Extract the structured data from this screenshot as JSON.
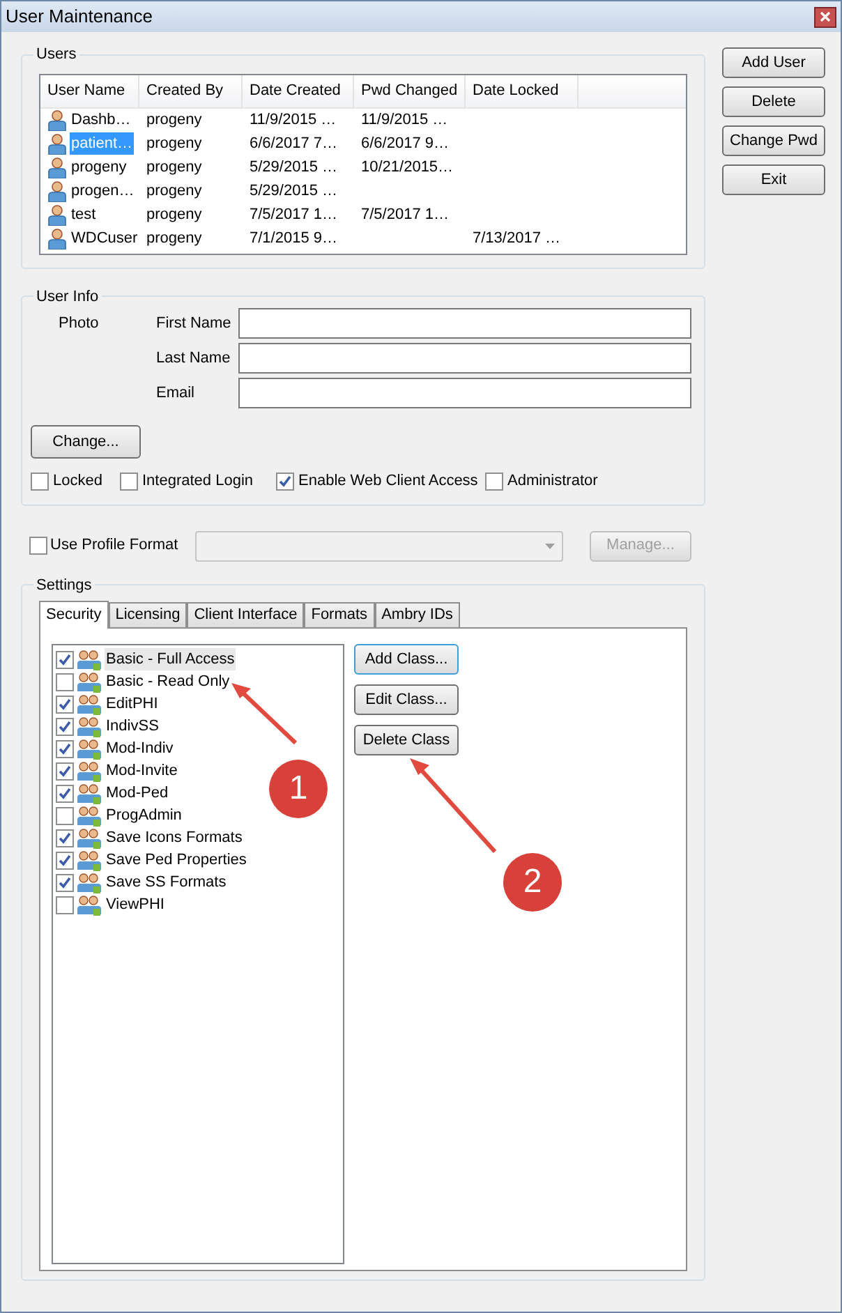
{
  "window": {
    "title": "User Maintenance"
  },
  "users": {
    "title": "Users",
    "columns": [
      "User Name",
      "Created By",
      "Date Created",
      "Pwd Changed",
      "Date Locked"
    ],
    "rows": [
      {
        "cells": [
          "Dashb…",
          "progeny",
          "11/9/2015 …",
          "11/9/2015 …",
          ""
        ],
        "selected": false
      },
      {
        "cells": [
          "patient…",
          "progeny",
          "6/6/2017 7…",
          "6/6/2017 9…",
          ""
        ],
        "selected": true
      },
      {
        "cells": [
          "progeny",
          "progeny",
          "5/29/2015 …",
          "10/21/2015…",
          ""
        ],
        "selected": false
      },
      {
        "cells": [
          "progen…",
          "progeny",
          "5/29/2015 …",
          "",
          ""
        ],
        "selected": false
      },
      {
        "cells": [
          "test",
          "progeny",
          "7/5/2017 1…",
          "7/5/2017 1…",
          ""
        ],
        "selected": false
      },
      {
        "cells": [
          "WDCuser",
          "progeny",
          "7/1/2015 9…",
          "",
          "7/13/2017 …"
        ],
        "selected": false
      }
    ]
  },
  "side_buttons": [
    "Add User",
    "Delete",
    "Change Pwd",
    "Exit"
  ],
  "user_info": {
    "title": "User Info",
    "photo_label": "Photo",
    "fields": [
      {
        "label": "First Name"
      },
      {
        "label": "Last Name"
      },
      {
        "label": "Email"
      }
    ],
    "change_button": "Change...",
    "options": [
      {
        "label": "Locked",
        "checked": false
      },
      {
        "label": "Integrated Login",
        "checked": false
      },
      {
        "label": "Enable Web Client Access",
        "checked": true
      },
      {
        "label": "Administrator",
        "checked": false
      }
    ]
  },
  "profile_format": {
    "label": "Use Profile Format",
    "checked": false,
    "manage_button": "Manage...",
    "manage_disabled": true
  },
  "settings": {
    "title": "Settings",
    "tabs": [
      {
        "label": "Security",
        "selected": true
      },
      {
        "label": "Licensing",
        "selected": false
      },
      {
        "label": "Client Interface",
        "selected": false
      },
      {
        "label": "Formats",
        "selected": false
      },
      {
        "label": "Ambry IDs",
        "selected": false
      }
    ],
    "classes": [
      {
        "label": "Basic - Full Access",
        "checked": true,
        "selected": true
      },
      {
        "label": "Basic - Read Only",
        "checked": false,
        "selected": false
      },
      {
        "label": "EditPHI",
        "checked": true,
        "selected": false
      },
      {
        "label": "IndivSS",
        "checked": true,
        "selected": false
      },
      {
        "label": "Mod-Indiv",
        "checked": true,
        "selected": false
      },
      {
        "label": "Mod-Invite",
        "checked": true,
        "selected": false
      },
      {
        "label": "Mod-Ped",
        "checked": true,
        "selected": false
      },
      {
        "label": "ProgAdmin",
        "checked": false,
        "selected": false
      },
      {
        "label": "Save Icons Formats",
        "checked": true,
        "selected": false
      },
      {
        "label": "Save Ped Properties",
        "checked": true,
        "selected": false
      },
      {
        "label": "Save SS Formats",
        "checked": true,
        "selected": false
      },
      {
        "label": "ViewPHI",
        "checked": false,
        "selected": false
      }
    ],
    "class_buttons": [
      {
        "label": "Add Class...",
        "focused": true
      },
      {
        "label": "Edit Class...",
        "focused": false
      },
      {
        "label": "Delete Class",
        "focused": false
      }
    ]
  },
  "annotations": [
    {
      "label": "1"
    },
    {
      "label": "2"
    }
  ]
}
